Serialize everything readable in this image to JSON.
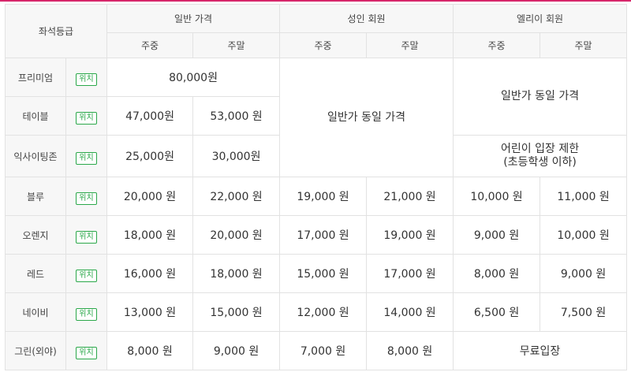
{
  "header": {
    "seat_grade": "좌석등급",
    "groups": [
      "일반 가격",
      "성인 회원",
      "엘리이 회원"
    ],
    "weekday": "주중",
    "weekend": "주말"
  },
  "badge_label": "위치",
  "rows": [
    {
      "seat": "프리미엄",
      "premium_price": "80,000원"
    },
    {
      "seat": "테이블",
      "general_weekday": "47,000원",
      "general_weekend": "53,000 원"
    },
    {
      "seat": "익사이팅존",
      "general_weekday": "25,000원",
      "general_weekend": "30,000원"
    },
    {
      "seat": "블루",
      "prices": [
        "20,000 원",
        "22,000 원",
        "19,000 원",
        "21,000 원",
        "10,000 원",
        "11,000 원"
      ]
    },
    {
      "seat": "오렌지",
      "prices": [
        "18,000 원",
        "20,000 원",
        "17,000 원",
        "19,000 원",
        "9,000 원",
        "10,000 원"
      ]
    },
    {
      "seat": "레드",
      "prices": [
        "16,000 원",
        "18,000 원",
        "15,000 원",
        "17,000 원",
        "8,000 원",
        "9,000 원"
      ]
    },
    {
      "seat": "네이비",
      "prices": [
        "13,000 원",
        "15,000 원",
        "12,000 원",
        "14,000 원",
        "6,500 원",
        "7,500 원"
      ]
    },
    {
      "seat": "그린(외야)",
      "prices": [
        "8,000 원",
        "9,000 원",
        "7,000 원",
        "8,000 원"
      ],
      "kids_free": "무료입장"
    }
  ],
  "merged": {
    "same_as_general": "일반가 동일 가격",
    "kids_restriction_line1": "어린이 입장 제한",
    "kids_restriction_line2": "(초등학생 이하)"
  },
  "colors": {
    "accent": "#d7266a",
    "badge": "#2ba84a",
    "header_bg": "#f7f7f7",
    "border": "#e2e2e2"
  }
}
